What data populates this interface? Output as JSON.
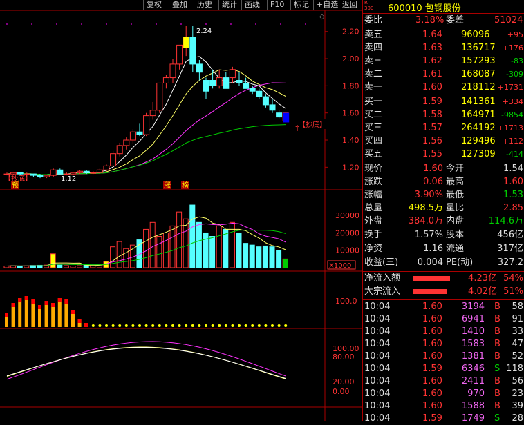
{
  "toolbar": {
    "buttons": [
      "复权",
      "叠加",
      "历史",
      "统计",
      "画线",
      "F10",
      "标记",
      "+自选",
      "返回"
    ]
  },
  "stock": {
    "code": "600010",
    "name": "包钢股份",
    "badge_r": "R",
    "badge_num": "300"
  },
  "weibi": {
    "label1": "委比",
    "val1": "3.18%",
    "label2": "委差",
    "val2": "51024"
  },
  "sell": [
    {
      "label": "卖五",
      "price": "1.64",
      "vol": "96096",
      "chg": "+95"
    },
    {
      "label": "卖四",
      "price": "1.63",
      "vol": "136717",
      "chg": "+176"
    },
    {
      "label": "卖三",
      "price": "1.62",
      "vol": "157293",
      "chg": "-83"
    },
    {
      "label": "卖二",
      "price": "1.61",
      "vol": "168087",
      "chg": "-309"
    },
    {
      "label": "卖一",
      "price": "1.60",
      "vol": "218112",
      "chg": "+1731"
    }
  ],
  "buy": [
    {
      "label": "买一",
      "price": "1.59",
      "vol": "141361",
      "chg": "+334"
    },
    {
      "label": "买二",
      "price": "1.58",
      "vol": "164971",
      "chg": "-9854"
    },
    {
      "label": "买三",
      "price": "1.57",
      "vol": "264192",
      "chg": "+1713"
    },
    {
      "label": "买四",
      "price": "1.56",
      "vol": "129496",
      "chg": "+112"
    },
    {
      "label": "买五",
      "price": "1.55",
      "vol": "127309",
      "chg": "-414"
    }
  ],
  "quote": [
    {
      "l1": "现价",
      "v1": "1.60",
      "l2": "今开",
      "v2": "1.54",
      "c1": "r",
      "c2": "w"
    },
    {
      "l1": "涨跌",
      "v1": "0.06",
      "l2": "最高",
      "v2": "1.60",
      "c1": "r",
      "c2": "r"
    },
    {
      "l1": "涨幅",
      "v1": "3.90%",
      "l2": "最低",
      "v2": "1.53",
      "c1": "r",
      "c2": "g"
    },
    {
      "l1": "总量",
      "v1": "498.5万",
      "l2": "量比",
      "v2": "2.85",
      "c1": "y",
      "c2": "r"
    },
    {
      "l1": "外盘",
      "v1": "384.0万",
      "l2": "内盘",
      "v2": "114.6万",
      "c1": "r",
      "c2": "g"
    }
  ],
  "info": [
    {
      "l1": "换手",
      "v1": "1.57%",
      "l2": "股本",
      "v2": "456亿"
    },
    {
      "l1": "净资",
      "v1": "1.16",
      "l2": "流通",
      "v2": "317亿"
    },
    {
      "l1": "收益(三)",
      "v1": "0.004",
      "l2": "PE(动)",
      "v2": "327.2"
    }
  ],
  "flow": [
    {
      "label": "净流入额",
      "val": "4.23亿",
      "pct": "54%"
    },
    {
      "label": "大宗流入",
      "val": "4.02亿",
      "pct": "51%"
    }
  ],
  "ticks": [
    {
      "t": "10:04",
      "p": "1.60",
      "v": "3194",
      "bs": "B",
      "n": "58"
    },
    {
      "t": "10:04",
      "p": "1.60",
      "v": "6941",
      "bs": "B",
      "n": "91"
    },
    {
      "t": "10:04",
      "p": "1.60",
      "v": "1410",
      "bs": "B",
      "n": "33"
    },
    {
      "t": "10:04",
      "p": "1.60",
      "v": "1583",
      "bs": "B",
      "n": "47"
    },
    {
      "t": "10:04",
      "p": "1.60",
      "v": "1381",
      "bs": "B",
      "n": "52"
    },
    {
      "t": "10:04",
      "p": "1.59",
      "v": "6346",
      "bs": "S",
      "n": "118"
    },
    {
      "t": "10:04",
      "p": "1.60",
      "v": "2411",
      "bs": "B",
      "n": "56"
    },
    {
      "t": "10:04",
      "p": "1.60",
      "v": "970",
      "bs": "B",
      "n": "23"
    },
    {
      "t": "10:04",
      "p": "1.60",
      "v": "1588",
      "bs": "B",
      "n": "39"
    },
    {
      "t": "10:04",
      "p": "1.59",
      "v": "1749",
      "bs": "S",
      "n": "28"
    }
  ],
  "chart_annotations": {
    "high_label": "2.24",
    "chaodi_right": "【抄底】",
    "chaodi_left": "【抄底】",
    "low_label": "1.12",
    "yu": "预",
    "zhang": "涨",
    "bang": "榜",
    "vol_unit": "X1000"
  },
  "price_axis": [
    "2.20",
    "2.00",
    "1.80",
    "1.60",
    "1.40",
    "1.20"
  ],
  "vol_axis": [
    "30000",
    "20000",
    "10000"
  ],
  "ind1_axis": [
    "100.0"
  ],
  "ind2_axis": [
    "100.00",
    "80.00",
    "20.00",
    "0.00"
  ],
  "chart_data": {
    "type": "candlestick",
    "candles": [
      [
        1.15,
        1.16,
        1.14,
        1.15
      ],
      [
        1.15,
        1.16,
        1.14,
        1.16
      ],
      [
        1.16,
        1.16,
        1.14,
        1.15
      ],
      [
        1.15,
        1.16,
        1.14,
        1.15
      ],
      [
        1.15,
        1.15,
        1.13,
        1.14
      ],
      [
        1.14,
        1.15,
        1.12,
        1.13
      ],
      [
        1.13,
        1.14,
        1.12,
        1.14
      ],
      [
        1.14,
        1.19,
        1.13,
        1.18
      ],
      [
        1.18,
        1.19,
        1.15,
        1.15
      ],
      [
        1.15,
        1.16,
        1.14,
        1.15
      ],
      [
        1.15,
        1.16,
        1.14,
        1.16
      ],
      [
        1.16,
        1.18,
        1.15,
        1.17
      ],
      [
        1.17,
        1.18,
        1.15,
        1.16
      ],
      [
        1.16,
        1.17,
        1.15,
        1.16
      ],
      [
        1.16,
        1.19,
        1.15,
        1.18
      ],
      [
        1.18,
        1.22,
        1.17,
        1.21
      ],
      [
        1.21,
        1.32,
        1.2,
        1.3
      ],
      [
        1.3,
        1.38,
        1.28,
        1.36
      ],
      [
        1.36,
        1.42,
        1.33,
        1.4
      ],
      [
        1.4,
        1.48,
        1.37,
        1.46
      ],
      [
        1.46,
        1.52,
        1.43,
        1.44
      ],
      [
        1.44,
        1.6,
        1.43,
        1.58
      ],
      [
        1.58,
        1.68,
        1.55,
        1.62
      ],
      [
        1.62,
        1.76,
        1.6,
        1.82
      ],
      [
        1.82,
        1.88,
        1.78,
        1.86
      ],
      [
        1.86,
        2.0,
        1.82,
        1.96
      ],
      [
        1.96,
        2.1,
        1.92,
        2.1
      ],
      [
        2.08,
        2.24,
        2.02,
        2.16
      ],
      [
        2.16,
        2.24,
        1.9,
        1.96
      ],
      [
        1.96,
        1.99,
        1.84,
        1.9
      ],
      [
        1.84,
        1.86,
        1.7,
        1.76
      ],
      [
        1.84,
        1.92,
        1.78,
        1.8
      ],
      [
        1.8,
        1.92,
        1.78,
        1.86
      ],
      [
        1.86,
        1.9,
        1.78,
        1.78
      ],
      [
        1.86,
        1.94,
        1.82,
        1.92
      ],
      [
        1.84,
        1.9,
        1.8,
        1.82
      ],
      [
        1.82,
        1.86,
        1.78,
        1.78
      ],
      [
        1.78,
        1.8,
        1.74,
        1.76
      ],
      [
        1.76,
        1.78,
        1.7,
        1.72
      ],
      [
        1.72,
        1.74,
        1.64,
        1.66
      ],
      [
        1.66,
        1.7,
        1.6,
        1.62
      ],
      [
        1.6,
        1.62,
        1.56,
        1.57
      ],
      [
        1.54,
        1.6,
        1.53,
        1.6
      ]
    ],
    "volumes": [
      1000,
      1200,
      900,
      1100,
      1300,
      1400,
      1500,
      8000,
      1500,
      1200,
      1000,
      1600,
      1400,
      1200,
      2000,
      3600,
      12000,
      15000,
      11000,
      13000,
      16000,
      22000,
      26000,
      18000,
      20000,
      24000,
      32000,
      28000,
      36000,
      26000,
      20000,
      18000,
      24000,
      22000,
      26000,
      20000,
      14000,
      13000,
      12000,
      12500,
      12000,
      10000,
      5000
    ],
    "ylim": [
      1.1,
      2.28
    ]
  }
}
